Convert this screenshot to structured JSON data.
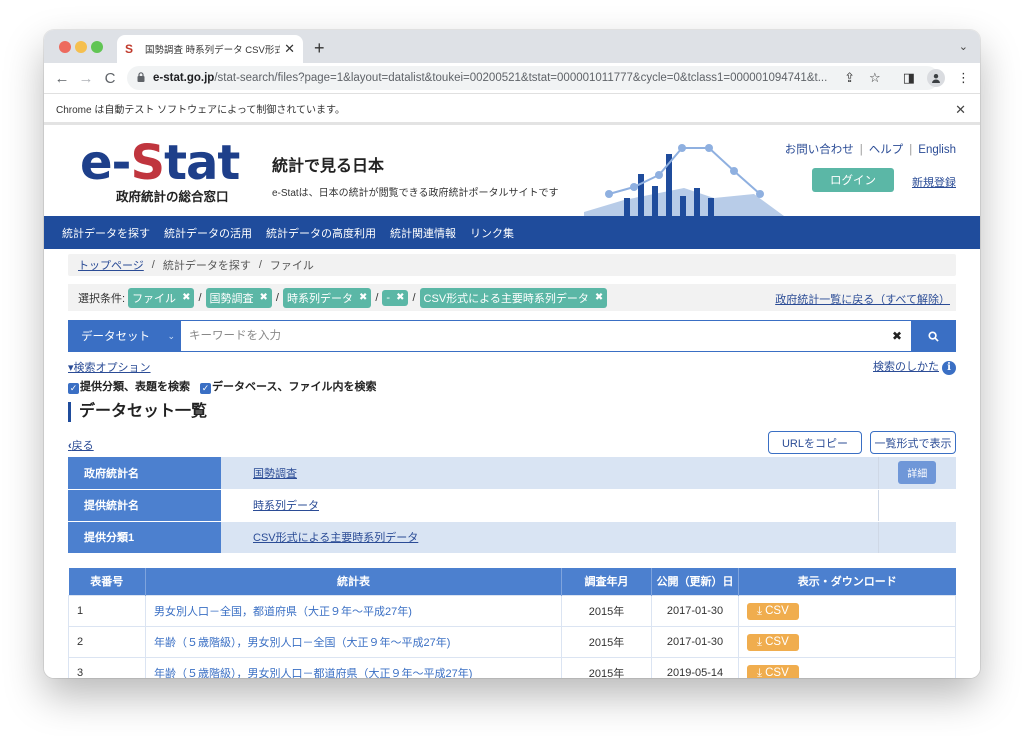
{
  "browser": {
    "tab_title": "国勢調査 時系列データ CSV形式に",
    "tab_favicon": "S",
    "new_tab_label": "+",
    "url_host": "e-stat.go.jp",
    "url_path": "/stat-search/files?page=1&layout=datalist&toukei=00200521&tstat=000001011777&cycle=0&tclass1=000001094741&t...",
    "infobar_text": "Chrome は自動テスト ソフトウェアによって制御されています。",
    "icons": {
      "back": "←",
      "forward": "→",
      "reload": "C",
      "lock": "🔒",
      "share": "⇪",
      "star": "☆",
      "sidepanel": "◨",
      "profile": "👤",
      "menu": "⋮",
      "close": "✕",
      "tab_menu": "⌄"
    }
  },
  "header": {
    "logo_e": "e-",
    "logo_s": "S",
    "logo_tat": "tat",
    "logo_sub": "政府統計の総合窓口",
    "tagline_title": "統計で見る日本",
    "tagline_desc": "e-Statは、日本の統計が閲覧できる政府統計ポータルサイトです",
    "links": [
      "お問い合わせ",
      "ヘルプ",
      "English"
    ],
    "link_sep": "|",
    "login_label": "ログイン",
    "register_label": "新規登録"
  },
  "colors": {
    "brand_blue": "#1f4c9c",
    "accent_green": "#5bb7a6",
    "logo_red": "#c0353e",
    "table_header": "#4c80cf",
    "csv_orange": "#f0ad4e"
  },
  "global_nav": [
    "統計データを探す",
    "統計データの活用",
    "統計データの高度利用",
    "統計関連情報",
    "リンク集"
  ],
  "breadcrumb": {
    "items": [
      "トップページ",
      "統計データを探す",
      "ファイル"
    ],
    "sep": "/"
  },
  "conditions": {
    "label": "選択条件:",
    "chips": [
      "ファイル",
      "国勢調査",
      "時系列データ",
      "-",
      "CSV形式による主要時系列データ"
    ],
    "remove_icon": "✖",
    "sep": "/",
    "reset_link": "政府統計一覧に戻る（すべて解除）"
  },
  "search": {
    "scope": "データセット",
    "scope_chevron": "⌄",
    "placeholder": "キーワードを入力",
    "value": "",
    "clear_icon": "✖",
    "search_icon": "🔍",
    "options_toggle": "▾検索オプション",
    "checkbox1": "提供分類、表題を検索",
    "checkbox2": "データベース、ファイル内を検索",
    "checkbox1_checked": true,
    "checkbox2_checked": true,
    "howto_link": "検索のしかた",
    "info_icon": "i"
  },
  "section": {
    "title": "データセット一覧",
    "back_link": "戻る",
    "back_icon": "‹",
    "copy_url_btn": "URLをコピー",
    "list_view_btn": "一覧形式で表示"
  },
  "meta": {
    "rows": [
      {
        "key": "政府統計名",
        "value": "国勢調査"
      },
      {
        "key": "提供統計名",
        "value": "時系列データ"
      },
      {
        "key": "提供分類1",
        "value": "CSV形式による主要時系列データ"
      }
    ],
    "detail_btn": "詳細"
  },
  "table": {
    "headers": [
      "表番号",
      "統計表",
      "調査年月",
      "公開（更新）日",
      "表示・ダウンロード"
    ],
    "csv_label": "CSV",
    "download_icon": "⤓",
    "rows": [
      {
        "no": "1",
        "title": "男女別人口－全国，都道府県（大正９年～平成27年)",
        "survey": "2015年",
        "published": "2017-01-30"
      },
      {
        "no": "2",
        "title": "年齢（５歳階級），男女別人口－全国（大正９年～平成27年)",
        "survey": "2015年",
        "published": "2017-01-30"
      },
      {
        "no": "3",
        "title": "年齢（５歳階級），男女別人口－都道府県（大正９年～平成27年)",
        "survey": "2015年",
        "published": "2019-05-14"
      }
    ]
  }
}
